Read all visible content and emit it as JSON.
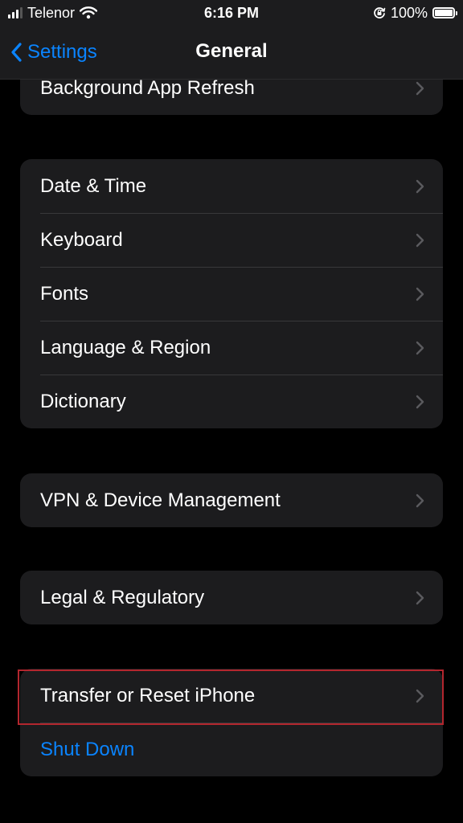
{
  "status_bar": {
    "carrier": "Telenor",
    "time": "6:16 PM",
    "battery_percent": "100%",
    "battery_level": 1.0,
    "icons": [
      "signal-icon",
      "wifi-icon",
      "orientation-lock-icon",
      "battery-icon"
    ]
  },
  "nav": {
    "back_label": "Settings",
    "title": "General"
  },
  "groups": {
    "top": {
      "items": [
        {
          "label": "Background App Refresh"
        }
      ]
    },
    "date_locale": {
      "items": [
        {
          "label": "Date & Time"
        },
        {
          "label": "Keyboard"
        },
        {
          "label": "Fonts"
        },
        {
          "label": "Language & Region"
        },
        {
          "label": "Dictionary"
        }
      ]
    },
    "vpn": {
      "items": [
        {
          "label": "VPN & Device Management"
        }
      ]
    },
    "legal": {
      "items": [
        {
          "label": "Legal & Regulatory"
        }
      ]
    },
    "reset": {
      "items": [
        {
          "label": "Transfer or Reset iPhone"
        },
        {
          "label": "Shut Down"
        }
      ]
    }
  },
  "colors": {
    "accent": "#0a84ff",
    "background": "#000000",
    "cell": "#1c1c1e",
    "highlight": "#b3262e"
  }
}
